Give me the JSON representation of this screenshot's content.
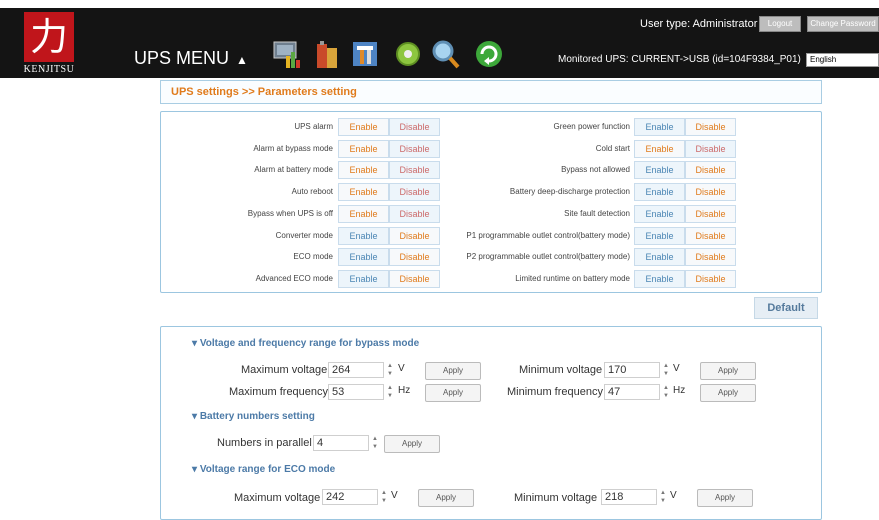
{
  "header": {
    "logo_glyph": "力",
    "logo_text": "KENJITSU",
    "ups_menu_label": "UPS MENU",
    "ups_menu_arrow": "▲",
    "user_type": "User type: Administrator",
    "logout_label": "Logout",
    "change_password_label": "Change Password",
    "monitored_ups": "Monitored UPS: CURRENT->USB (id=104F9384_P01)",
    "language": "English",
    "toolbar_icons": [
      "status-chart-icon",
      "battery-icon",
      "settings-tools-icon",
      "gear-icon",
      "search-icon",
      "refresh-icon"
    ]
  },
  "breadcrumb": "UPS settings >> Parameters setting",
  "params": {
    "enable_label": "Enable",
    "disable_label": "Disable",
    "left": [
      {
        "label": "UPS alarm",
        "selected": "enable"
      },
      {
        "label": "Alarm at bypass mode",
        "selected": "enable"
      },
      {
        "label": "Alarm at battery mode",
        "selected": "enable"
      },
      {
        "label": "Auto reboot",
        "selected": "enable"
      },
      {
        "label": "Bypass when UPS is off",
        "selected": "enable"
      },
      {
        "label": "Converter mode",
        "selected": "disable"
      },
      {
        "label": "ECO mode",
        "selected": "disable"
      },
      {
        "label": "Advanced ECO mode",
        "selected": "disable"
      }
    ],
    "right": [
      {
        "label": "Green power function",
        "selected": "disable"
      },
      {
        "label": "Cold start",
        "selected": "enable"
      },
      {
        "label": "Bypass not allowed",
        "selected": "disable"
      },
      {
        "label": "Battery deep-discharge protection",
        "selected": "disable"
      },
      {
        "label": "Site fault detection",
        "selected": "disable"
      },
      {
        "label": "P1 programmable outlet control(battery mode)",
        "selected": "disable"
      },
      {
        "label": "P2 programmable outlet control(battery mode)",
        "selected": "disable"
      },
      {
        "label": "Limited runtime on battery mode",
        "selected": "disable"
      }
    ]
  },
  "default_label": "Default",
  "ranges": {
    "apply_label": "Apply",
    "bypass_title": "Voltage and frequency range for bypass mode",
    "max_voltage_label": "Maximum voltage",
    "max_voltage": "264",
    "min_voltage_label": "Minimum voltage",
    "min_voltage": "170",
    "max_freq_label": "Maximum frequency",
    "max_freq": "53",
    "min_freq_label": "Minimum frequency",
    "min_freq": "47",
    "unit_v": "V",
    "unit_hz": "Hz",
    "battery_title": "Battery numbers setting",
    "parallel_label": "Numbers in parallel",
    "parallel": "4",
    "eco_title": "Voltage range for ECO mode",
    "eco_max_label": "Maximum voltage",
    "eco_max": "242",
    "eco_min_label": "Minimum voltage",
    "eco_min": "218"
  }
}
